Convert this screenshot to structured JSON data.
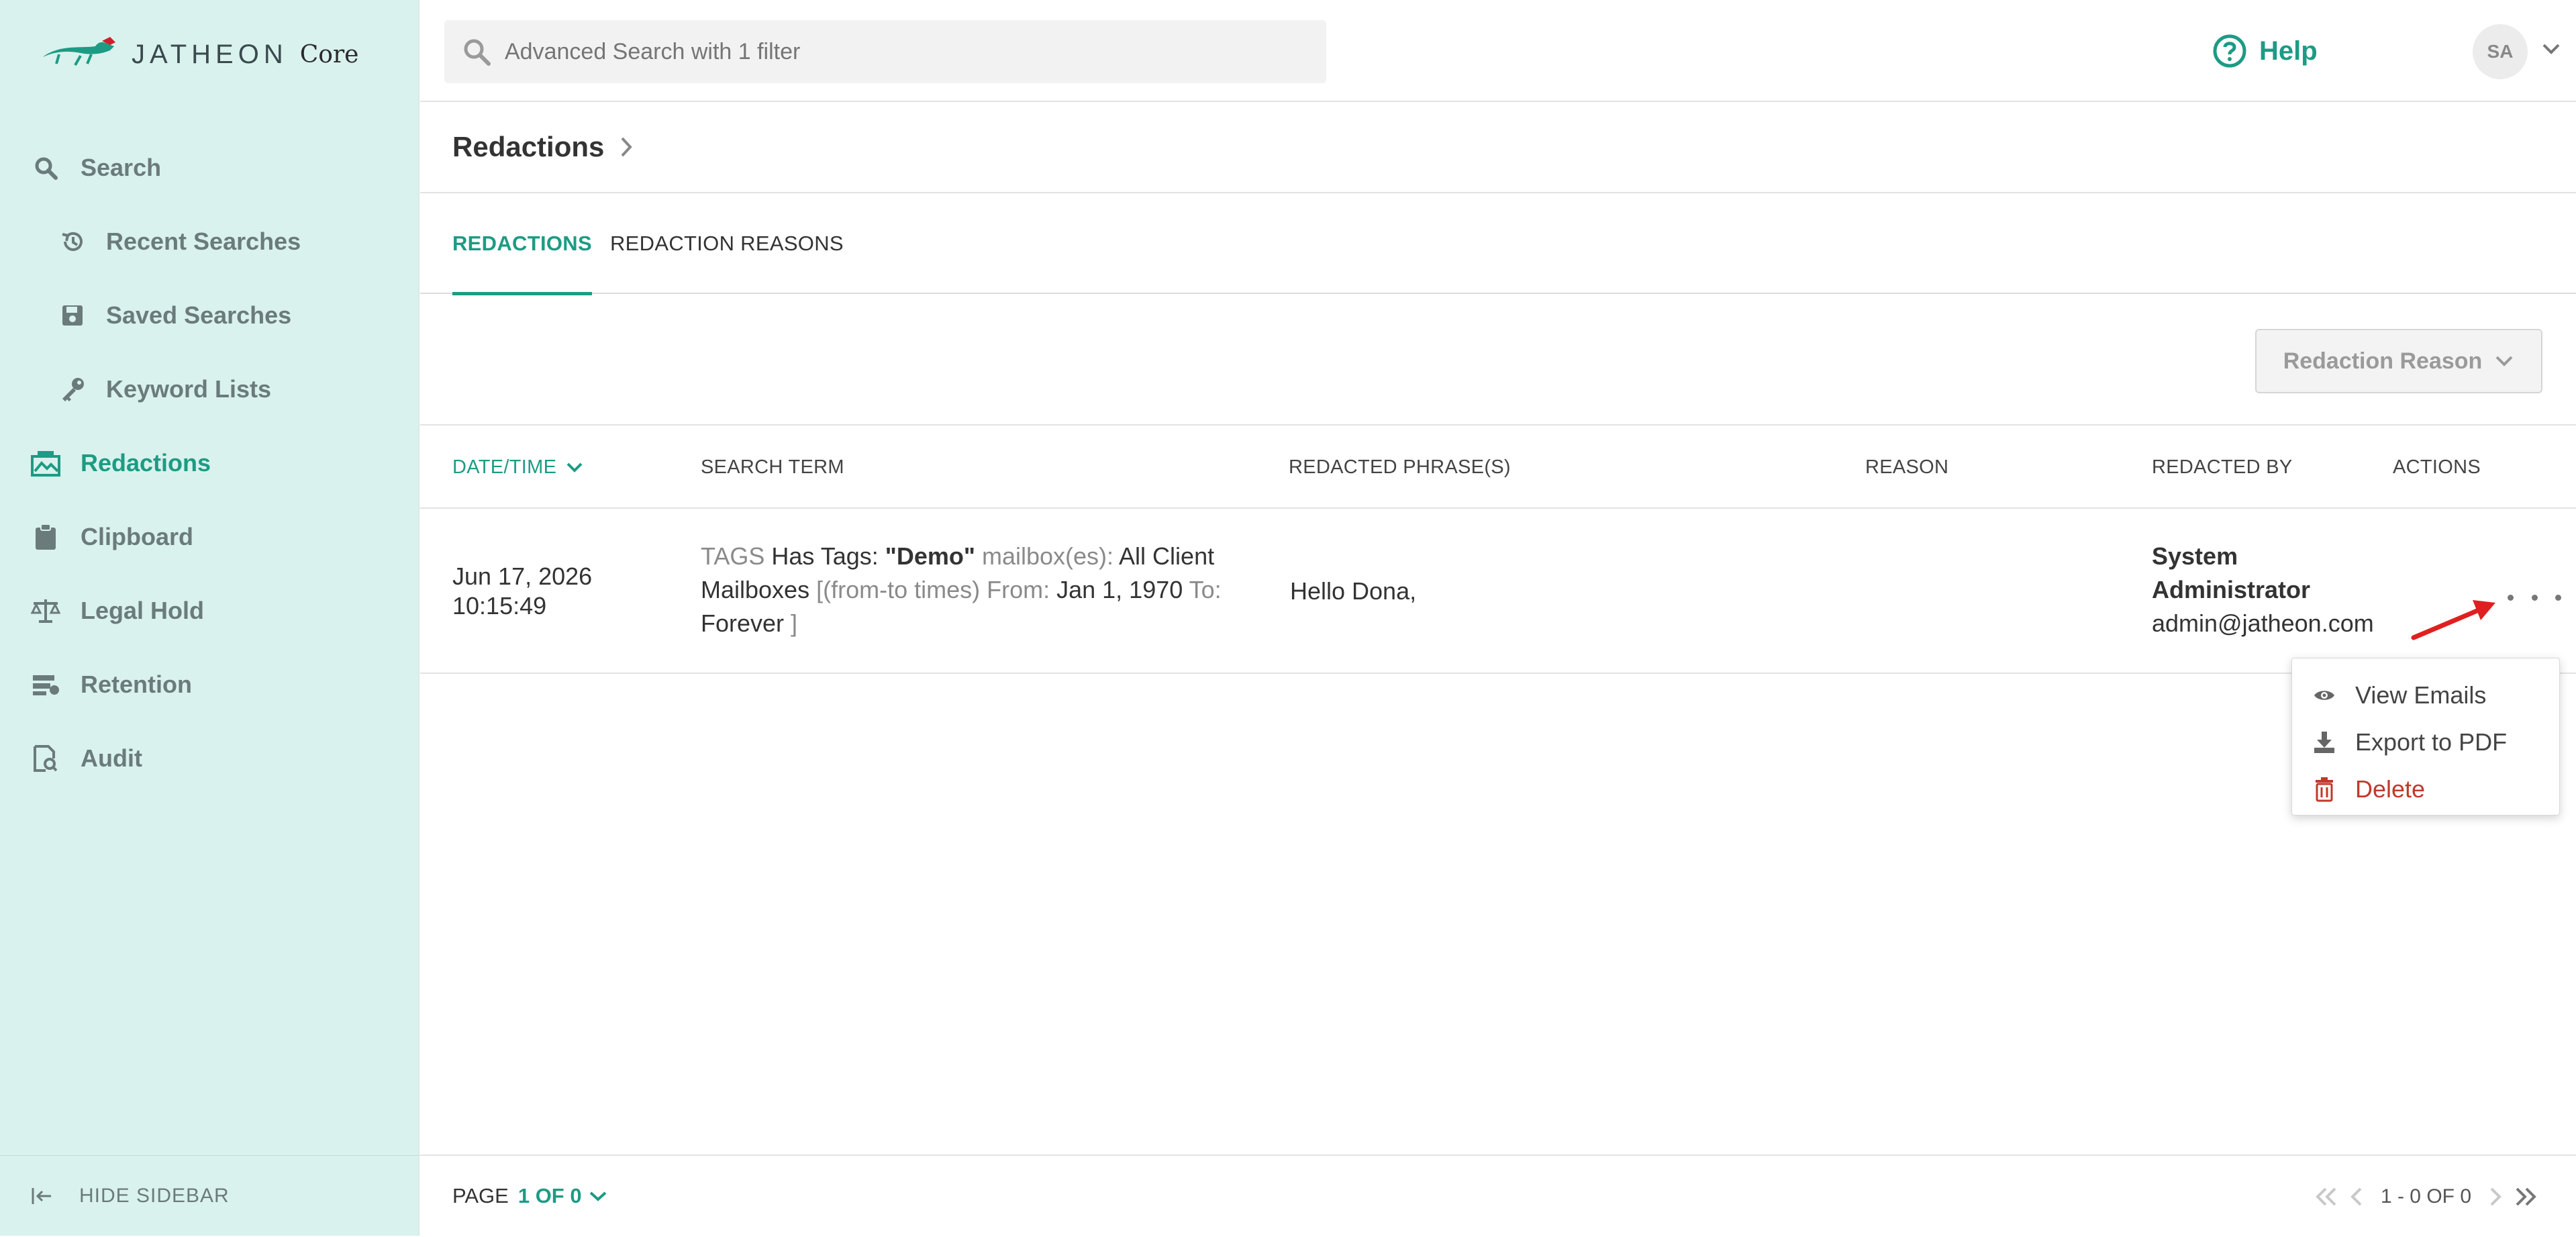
{
  "app": {
    "logo_text": "JATHEON",
    "logo_suffix": "Core"
  },
  "sidebar": {
    "items": [
      {
        "label": "Search",
        "icon": "search-icon"
      },
      {
        "label": "Recent Searches",
        "icon": "history-icon"
      },
      {
        "label": "Saved Searches",
        "icon": "floppy-disk-icon"
      },
      {
        "label": "Keyword Lists",
        "icon": "key-icon"
      },
      {
        "label": "Redactions",
        "icon": "redaction-icon",
        "active": true
      },
      {
        "label": "Clipboard",
        "icon": "clipboard-icon"
      },
      {
        "label": "Legal Hold",
        "icon": "scale-icon"
      },
      {
        "label": "Retention",
        "icon": "retention-icon"
      },
      {
        "label": "Audit",
        "icon": "audit-icon"
      }
    ],
    "hide_label": "HIDE SIDEBAR"
  },
  "topbar": {
    "search_placeholder": "Advanced Search with 1 filter",
    "help_label": "Help",
    "avatar_initials": "SA"
  },
  "page": {
    "title": "Redactions",
    "tabs": [
      {
        "label": "REDACTIONS",
        "active": true
      },
      {
        "label": "REDACTION REASONS",
        "active": false
      }
    ],
    "filter_button": "Redaction Reason"
  },
  "table": {
    "headers": {
      "datetime": "DATE/TIME",
      "search_term": "SEARCH TERM",
      "phrases": "REDACTED PHRASE(S)",
      "reason": "REASON",
      "redacted_by": "REDACTED BY",
      "actions": "ACTIONS"
    },
    "rows": [
      {
        "date": "Jun 17, 2026",
        "time": "10:15:49",
        "term": {
          "tags_label": "TAGS",
          "has_tags": "Has Tags:",
          "tag_value": "\"Demo\"",
          "mailbox_label": "mailbox(es):",
          "mailbox_value_1": "All Client",
          "mailbox_value_2": "Mailboxes",
          "range_label": "[(from-to times) From:",
          "from_value": "Jan 1, 1970",
          "to_label": "To:",
          "to_value": "Forever",
          "close": "]"
        },
        "phrase": "Hello Dona,",
        "reason": "",
        "redactor_name_1": "System",
        "redactor_name_2": "Administrator",
        "redactor_email": "admin@jatheon.com"
      }
    ]
  },
  "actions_menu": {
    "items": [
      {
        "label": "View Emails",
        "icon": "eye-icon"
      },
      {
        "label": "Export to PDF",
        "icon": "download-icon"
      },
      {
        "label": "Delete",
        "icon": "trash-icon"
      }
    ]
  },
  "footer": {
    "page_label": "PAGE",
    "page_value": "1 OF 0",
    "range": "1 - 0 OF 0"
  },
  "colors": {
    "accent": "#1d9b84",
    "sidebar_bg": "#d9f2ed",
    "danger": "#c0392b",
    "annotation": "#e02020"
  }
}
